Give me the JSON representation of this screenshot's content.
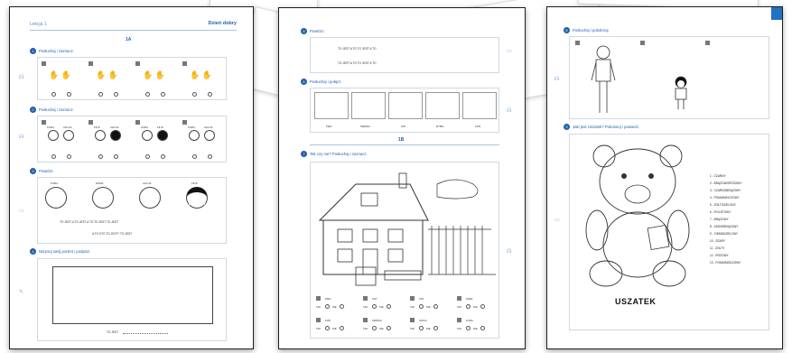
{
  "page1": {
    "header_left": "Lekcja 1",
    "header_right": "Dzień dobry",
    "part_label": "1A",
    "sections": [
      {
        "num": "1",
        "title": "Posłuchaj i zaznacz."
      },
      {
        "num": "2",
        "title": "Posłuchaj i zaznacz."
      },
      {
        "num": "3",
        "title": "Powtórz."
      },
      {
        "num": "4",
        "title": "Narysuj swój portret i podpisz."
      }
    ],
    "names": [
      "ZUZIA",
      "MAMA",
      "ALICJA",
      "FILIP"
    ],
    "row2_names": [
      "ZUZIA",
      "ALICJA",
      "FILIP",
      "ALICJA",
      "ZUZIA",
      "FILIP",
      "ZUZIA",
      "ALICJA"
    ],
    "sentence_1": "TO JEST   A TO JEST   A TO TO JEST   TO JEST",
    "sentence_2": "A TO KTO TO JEST? TO JEST",
    "caption": "TO JEST"
  },
  "page2": {
    "sections": [
      {
        "num": "5",
        "title": "Powtórz."
      },
      {
        "num": "6",
        "title": "Posłuchaj i połącz."
      },
      {
        "num": "7",
        "title": "Tak czy nie? Posłuchaj i zaznacz."
      }
    ],
    "repeat_line_1": "TO JEST   A TO   TO JEST   A TO",
    "repeat_line_2": "TO JEST   A TO   TO JEST   A TO",
    "animals": [
      "PIES",
      "ŚWINKA",
      "KOT",
      "RYBKI",
      "KOŃ"
    ],
    "part_label": "1B",
    "yes_no_items": [
      {
        "word": "PIES",
        "yes": "TAK",
        "no": "NIE"
      },
      {
        "word": "KOT",
        "yes": "TAK",
        "no": "NIE"
      },
      {
        "word": "KOT",
        "yes": "TAK",
        "no": "NIE"
      },
      {
        "word": "ŻABA",
        "yes": "TAK",
        "no": "NIE"
      },
      {
        "word": "KOŃ",
        "yes": "TAK",
        "no": "NIE"
      },
      {
        "word": "ŚWINKA",
        "yes": "TAK",
        "no": "NIE"
      },
      {
        "word": "OWCA",
        "yes": "TAK",
        "no": "NIE"
      },
      {
        "word": "KURA",
        "yes": "TAK",
        "no": "NIE"
      }
    ]
  },
  "page3": {
    "sections": [
      {
        "num": "8",
        "title": "Posłuchaj i pokoloruj."
      },
      {
        "num": "9",
        "title": "Jaki jest Uszatek? Pokoloruj i powiedz."
      }
    ],
    "legend": [
      "1 - CZARNY",
      "2 - BRĄZOWORÓŻOWY",
      "3 - CZARNOBRĄZOWY",
      "4 - POMARAŃCZOWY",
      "5 - ŻÓŁTOZIELONY",
      "6 - FIOLETOWY",
      "7 - BRĄZOWY",
      "8 - JASNOBRĄZOWY",
      "9 - CIEMNOZIELONY",
      "10 - SZARY",
      "11 - ŻÓŁTY",
      "12 - RÓŻOWY",
      "13 - POMARAŃCZOWY"
    ],
    "bear_name": "USZATEK"
  },
  "colors": {
    "accent": "#1f5fb0",
    "tab": "#1f72c4"
  }
}
